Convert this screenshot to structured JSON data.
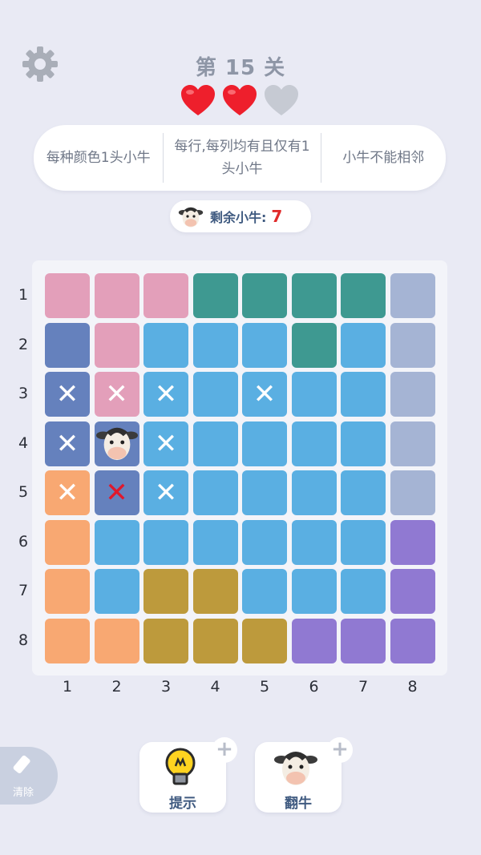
{
  "header": {
    "level_title": "第 15 关",
    "lives": {
      "total": 3,
      "remaining": 2
    },
    "settings_icon": "gear-icon"
  },
  "rules": [
    "每种颜色1头小牛",
    "每行,每列均有且仅有1头小牛",
    "小牛不能相邻"
  ],
  "remaining": {
    "label": "剩余小牛:",
    "count": "7"
  },
  "board": {
    "size": 8,
    "row_labels": [
      "1",
      "2",
      "3",
      "4",
      "5",
      "6",
      "7",
      "8"
    ],
    "col_labels": [
      "1",
      "2",
      "3",
      "4",
      "5",
      "6",
      "7",
      "8"
    ],
    "palette": {
      "P": "#e39fba",
      "T": "#3e9991",
      "S": "#a5b4d4",
      "B": "#6581bd",
      "L": "#5aafe2",
      "O": "#f8a872",
      "G": "#bd9a3c",
      "V": "#9079d2"
    },
    "regions": [
      "PPPTTTTS",
      "BPLLLTLS",
      "BPLLLLLS",
      "BBLLLLLS",
      "OBLLLLLS",
      "OLLLLLLV",
      "OLGGLLLV",
      "OOGGGVVV"
    ],
    "marks": [
      {
        "r": 3,
        "c": 1,
        "type": "x"
      },
      {
        "r": 3,
        "c": 2,
        "type": "x"
      },
      {
        "r": 3,
        "c": 3,
        "type": "x"
      },
      {
        "r": 3,
        "c": 5,
        "type": "x"
      },
      {
        "r": 4,
        "c": 1,
        "type": "x"
      },
      {
        "r": 4,
        "c": 2,
        "type": "cow"
      },
      {
        "r": 4,
        "c": 3,
        "type": "x"
      },
      {
        "r": 5,
        "c": 1,
        "type": "x"
      },
      {
        "r": 5,
        "c": 2,
        "type": "x-red"
      },
      {
        "r": 5,
        "c": 3,
        "type": "x"
      }
    ]
  },
  "tools": {
    "erase_label": "清除",
    "hint_label": "提示",
    "flip_label": "翻牛",
    "plus": "+"
  }
}
